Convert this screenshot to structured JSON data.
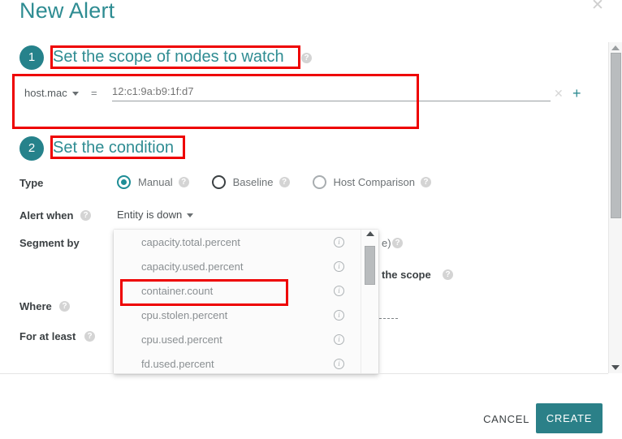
{
  "dialog": {
    "title": "New Alert",
    "close_icon": "close-icon"
  },
  "steps": [
    {
      "number": "1",
      "title": "Set the scope of nodes to watch",
      "has_help": true
    },
    {
      "number": "2",
      "title": "Set the condition",
      "has_help": false
    }
  ],
  "scope": {
    "key": "host.mac",
    "operator": "=",
    "value": "12:c1:9a:b9:1f:d7",
    "value_placeholder": "12:c1:9a:b9:1f:d7",
    "remove_icon": "close-icon",
    "add_icon": "plus-icon"
  },
  "condition": {
    "type_label": "Type",
    "type_options": [
      {
        "label": "Manual",
        "selected": true,
        "hovered": false
      },
      {
        "label": "Baseline",
        "selected": false,
        "hovered": true
      },
      {
        "label": "Host Comparison",
        "selected": false,
        "hovered": false
      }
    ],
    "alert_when_label": "Alert when",
    "alert_when_value": "Entity is down",
    "segment_by_label": "Segment by",
    "where_label": "Where",
    "for_at_least_label": "For at least",
    "obscured_text_1": "e)",
    "obscured_text_2": "the scope"
  },
  "dropdown": {
    "items": [
      {
        "label": "capacity.total.percent",
        "highlighted": false
      },
      {
        "label": "capacity.used.percent",
        "highlighted": false
      },
      {
        "label": "container.count",
        "highlighted": true
      },
      {
        "label": "cpu.stolen.percent",
        "highlighted": false
      },
      {
        "label": "cpu.used.percent",
        "highlighted": false
      },
      {
        "label": "fd.used.percent",
        "highlighted": false
      }
    ],
    "info_icon": "info-icon",
    "scroll_up_icon": "caret-up-icon"
  },
  "footer": {
    "cancel_label": "CANCEL",
    "create_label": "CREATE"
  },
  "colors": {
    "teal": "#2e8c92",
    "teal_dark": "#2b8088",
    "annotation_red": "#ee0000",
    "label_dark": "#3b4043",
    "muted_gray": "#8a8f92"
  }
}
